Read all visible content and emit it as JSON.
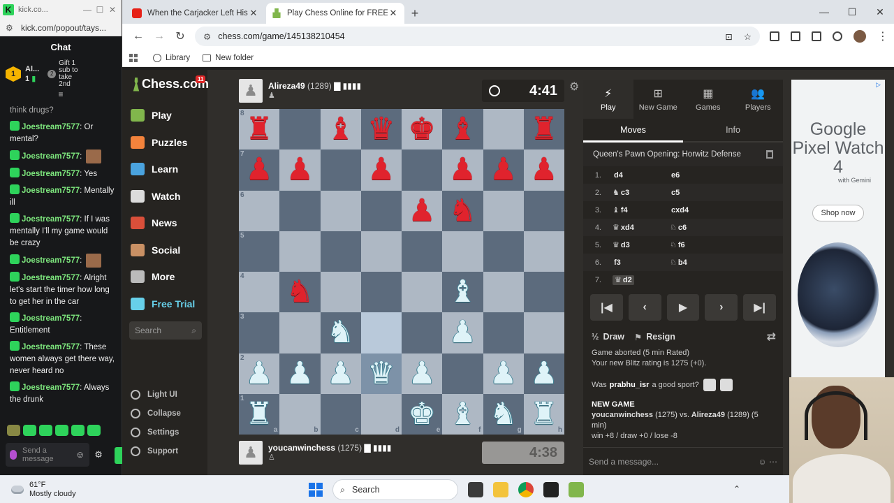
{
  "kick": {
    "title_url": "kick.co...",
    "url": "kick.com/popout/tays...",
    "chat_header": "Chat",
    "promo": {
      "rank": "1",
      "user": "Al...",
      "count": "1",
      "gift_text": "Gift 1 sub to take 2nd"
    },
    "messages": [
      {
        "user": "",
        "text": "think drugs?",
        "cut": true
      },
      {
        "user": "Joestream7577",
        "text": "Or mental?"
      },
      {
        "user": "Joestream7577",
        "text": "",
        "emote": true
      },
      {
        "user": "Joestream7577",
        "text": "Yes"
      },
      {
        "user": "Joestream7577",
        "text": "Mentally ill"
      },
      {
        "user": "Joestream7577",
        "text": "If I was mentally I'll my game would be crazy"
      },
      {
        "user": "Joestream7577",
        "text": "",
        "emote": true
      },
      {
        "user": "Joestream7577",
        "text": "Alright let's start the timer how long to get her in the car"
      },
      {
        "user": "Joestream7577",
        "text": "Entitlement"
      },
      {
        "user": "Joestream7577",
        "text": "These women always get there way, never heard no"
      },
      {
        "user": "Joestream7577",
        "text": "Always the drunk"
      }
    ],
    "input_placeholder": "Send a message"
  },
  "browser": {
    "tabs": [
      {
        "title": "When the Carjacker Left His ID",
        "favicon": "youtube",
        "active": false
      },
      {
        "title": "Play Chess Online for FREE - 2 P",
        "favicon": "chess",
        "active": true
      }
    ],
    "url": "chess.com/game/145138210454",
    "bookmarks": [
      "Library",
      "New folder"
    ]
  },
  "chess": {
    "logo": "Chess.com",
    "notif_count": "11",
    "nav": [
      {
        "label": "Play",
        "icon": "play-icon",
        "color": "#81b64c"
      },
      {
        "label": "Puzzles",
        "icon": "puzzle-icon",
        "color": "#f3833c"
      },
      {
        "label": "Learn",
        "icon": "learn-icon",
        "color": "#4aa3df"
      },
      {
        "label": "Watch",
        "icon": "binoculars-icon",
        "color": "#dcdcdc"
      },
      {
        "label": "News",
        "icon": "news-icon",
        "color": "#d94f3a"
      },
      {
        "label": "Social",
        "icon": "social-icon",
        "color": "#c99064"
      },
      {
        "label": "More",
        "icon": "more-icon",
        "color": "#bbbbbb"
      },
      {
        "label": "Free Trial",
        "icon": "diamond-icon",
        "color": "#67d0e9"
      }
    ],
    "search_placeholder": "Search",
    "footer": [
      "Light UI",
      "Collapse",
      "Settings",
      "Support"
    ],
    "top_player": {
      "name": "Alireza49",
      "rating": "(1289)",
      "clock": "4:41"
    },
    "bottom_player": {
      "name": "youcanwinchess",
      "rating": "(1275)",
      "clock": "4:38"
    },
    "board": [
      [
        "br",
        "",
        "bb",
        "bq",
        "bk",
        "bb",
        "",
        "br"
      ],
      [
        "bp",
        "bp",
        "",
        "bp",
        "",
        "bp",
        "bp",
        "bp"
      ],
      [
        "",
        "",
        "",
        "",
        "bp",
        "bn",
        "",
        ""
      ],
      [
        "",
        "",
        "",
        "",
        "",
        "",
        "",
        ""
      ],
      [
        "",
        "bn",
        "",
        "",
        "",
        "wb",
        "",
        ""
      ],
      [
        "",
        "",
        "wn",
        "",
        "",
        "wp",
        "",
        ""
      ],
      [
        "wp",
        "wp",
        "wp",
        "wq",
        "wp",
        "",
        "wp",
        "wp"
      ],
      [
        "wr",
        "",
        "",
        "",
        "wk",
        "wb",
        "wn",
        "wr"
      ]
    ],
    "highlight": [
      [
        5,
        3
      ],
      [
        6,
        3
      ]
    ],
    "files": [
      "a",
      "b",
      "c",
      "d",
      "e",
      "f",
      "g",
      "h"
    ],
    "ranks": [
      "8",
      "7",
      "6",
      "5",
      "4",
      "3",
      "2",
      "1"
    ],
    "right_nav": [
      "Play",
      "New Game",
      "Games",
      "Players"
    ],
    "subtabs": [
      "Moves",
      "Info"
    ],
    "opening": "Queen's Pawn Opening: Horwitz Defense",
    "moves": [
      {
        "no": "1.",
        "w": "d4",
        "wp": "",
        "b": "e6",
        "bp": ""
      },
      {
        "no": "2.",
        "w": "c3",
        "wp": "♞",
        "b": "c5",
        "bp": ""
      },
      {
        "no": "3.",
        "w": "f4",
        "wp": "♝",
        "b": "cxd4",
        "bp": ""
      },
      {
        "no": "4.",
        "w": "xd4",
        "wp": "♛",
        "b": "c6",
        "bp": "♘"
      },
      {
        "no": "5.",
        "w": "d3",
        "wp": "♛",
        "b": "f6",
        "bp": "♘"
      },
      {
        "no": "6.",
        "w": "f3",
        "wp": "",
        "b": "b4",
        "bp": "♘"
      },
      {
        "no": "7.",
        "w": "d2",
        "wp": "♛",
        "b": "",
        "bp": "",
        "current": true
      }
    ],
    "draw_label": "Draw",
    "resign_label": "Resign",
    "log": {
      "line1": "Game aborted (5 min Rated)",
      "line2": "Your new Blitz rating is 1275 (+0).",
      "question_pre": "Was",
      "question_user": "prabhu_isr",
      "question_post": "a good sport?",
      "new_game": "NEW GAME",
      "ng_p1": "youcanwinchess",
      "ng_p1r": "(1275)",
      "ng_vs": "vs.",
      "ng_p2": "Alireza49",
      "ng_p2r": "(1289)",
      "ng_tc": "(5 min)",
      "record": "win +8 / draw +0 / lose -8"
    },
    "send_placeholder": "Send a message..."
  },
  "ad": {
    "headline": "Google Pixel Watch 4",
    "sub": "with Gemini",
    "cta": "Shop now"
  },
  "taskbar": {
    "temp": "61°F",
    "condition": "Mostly cloudy",
    "search": "Search"
  }
}
